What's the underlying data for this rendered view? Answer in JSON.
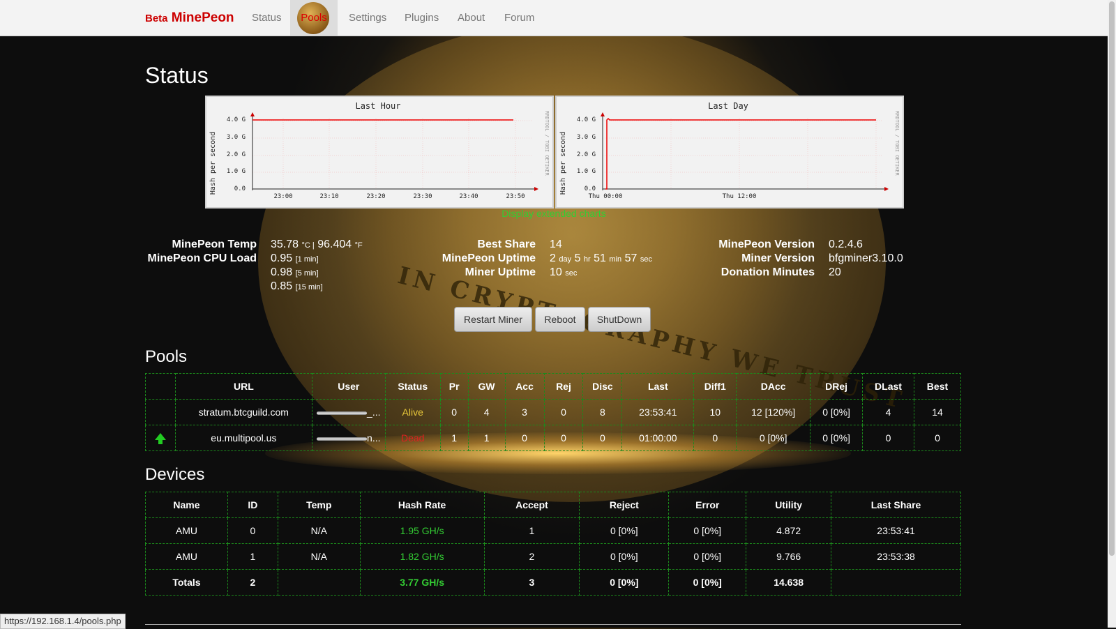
{
  "nav": {
    "brand_small": "Beta",
    "brand": "MinePeon",
    "items": [
      "Status",
      "Pools",
      "Settings",
      "Plugins",
      "About",
      "Forum"
    ],
    "active": "Pools"
  },
  "status": {
    "title": "Status",
    "charts": [
      {
        "title": "Last Hour",
        "ylabel": "Hash per second",
        "side_label": "RRDTOOL / TOBI OETIKER",
        "y_ticks": [
          "4.0 G",
          "3.0 G",
          "2.0 G",
          "1.0 G",
          "0.0"
        ],
        "x_ticks": [
          "23:00",
          "23:10",
          "23:20",
          "23:30",
          "23:40",
          "23:50"
        ]
      },
      {
        "title": "Last Day",
        "ylabel": "Hash per second",
        "side_label": "RRDTOOL / TOBI OETIKER",
        "y_ticks": [
          "4.0 G",
          "3.0 G",
          "2.0 G",
          "1.0 G",
          "0.0"
        ],
        "x_ticks": [
          "Thu 00:00",
          "Thu 12:00"
        ]
      }
    ],
    "extended_link": "Display extended charts",
    "stats": {
      "temp_label": "MinePeon Temp",
      "temp_c": "35.78",
      "temp_c_unit": "°C |",
      "temp_f": "96.404",
      "temp_f_unit": "°F",
      "cpu_label": "MinePeon CPU Load",
      "load_1": "0.95",
      "load_1_unit": "[1 min]",
      "load_5": "0.98",
      "load_5_unit": "[5 min]",
      "load_15": "0.85",
      "load_15_unit": "[15 min]",
      "best_share_label": "Best Share",
      "best_share": "14",
      "uptime_label": "MinePeon Uptime",
      "uptime_d": "2",
      "uptime_d_unit": "day",
      "uptime_h": "5",
      "uptime_h_unit": "hr",
      "uptime_m": "51",
      "uptime_m_unit": "min",
      "uptime_s": "57",
      "uptime_s_unit": "sec",
      "miner_uptime_label": "Miner Uptime",
      "miner_uptime": "10",
      "miner_uptime_unit": "sec",
      "version_label": "MinePeon Version",
      "version": "0.2.4.6",
      "miner_version_label": "Miner Version",
      "miner_version": "bfgminer3.10.0",
      "donation_label": "Donation Minutes",
      "donation": "20"
    },
    "buttons": {
      "restart": "Restart Miner",
      "reboot": "Reboot",
      "shutdown": "ShutDown"
    }
  },
  "pools": {
    "title": "Pools",
    "headers": [
      "",
      "URL",
      "User",
      "Status",
      "Pr",
      "GW",
      "Acc",
      "Rej",
      "Disc",
      "Last",
      "Diff1",
      "DAcc",
      "DRej",
      "DLast",
      "Best"
    ],
    "rows": [
      {
        "url": "stratum.btcguild.com",
        "user_suffix": "_...",
        "status": "Alive",
        "pr": "0",
        "gw": "4",
        "acc": "3",
        "rej": "0",
        "disc": "8",
        "last": "23:53:41",
        "diff1": "10",
        "dacc": "12 [120%]",
        "drej": "0 [0%]",
        "dlast": "4",
        "best": "14"
      },
      {
        "url": "eu.multipool.us",
        "user_suffix": "n...",
        "status": "Dead",
        "pr": "1",
        "gw": "1",
        "acc": "0",
        "rej": "0",
        "disc": "0",
        "last": "01:00:00",
        "diff1": "0",
        "dacc": "0 [0%]",
        "drej": "0 [0%]",
        "dlast": "0",
        "best": "0"
      }
    ]
  },
  "devices": {
    "title": "Devices",
    "headers": [
      "Name",
      "ID",
      "Temp",
      "Hash Rate",
      "Accept",
      "Reject",
      "Error",
      "Utility",
      "Last Share"
    ],
    "rows": [
      {
        "name": "AMU",
        "id": "0",
        "temp": "N/A",
        "rate": "1.95 GH/s",
        "accept": "1",
        "reject": "0 [0%]",
        "error": "0 [0%]",
        "utility": "4.872",
        "last": "23:53:41"
      },
      {
        "name": "AMU",
        "id": "1",
        "temp": "N/A",
        "rate": "1.82 GH/s",
        "accept": "2",
        "reject": "0 [0%]",
        "error": "0 [0%]",
        "utility": "9.766",
        "last": "23:53:38"
      }
    ],
    "totals": {
      "name": "Totals",
      "id": "2",
      "rate": "3.77 GH/s",
      "accept": "3",
      "reject": "0 [0%]",
      "error": "0 [0%]",
      "utility": "14.638"
    }
  },
  "statusbar_url": "https://192.168.1.4/pools.php",
  "colors": {
    "alive": "#e8c83a",
    "dead": "#e02020",
    "hashrate": "#33cc33",
    "brand": "#cc0000"
  }
}
